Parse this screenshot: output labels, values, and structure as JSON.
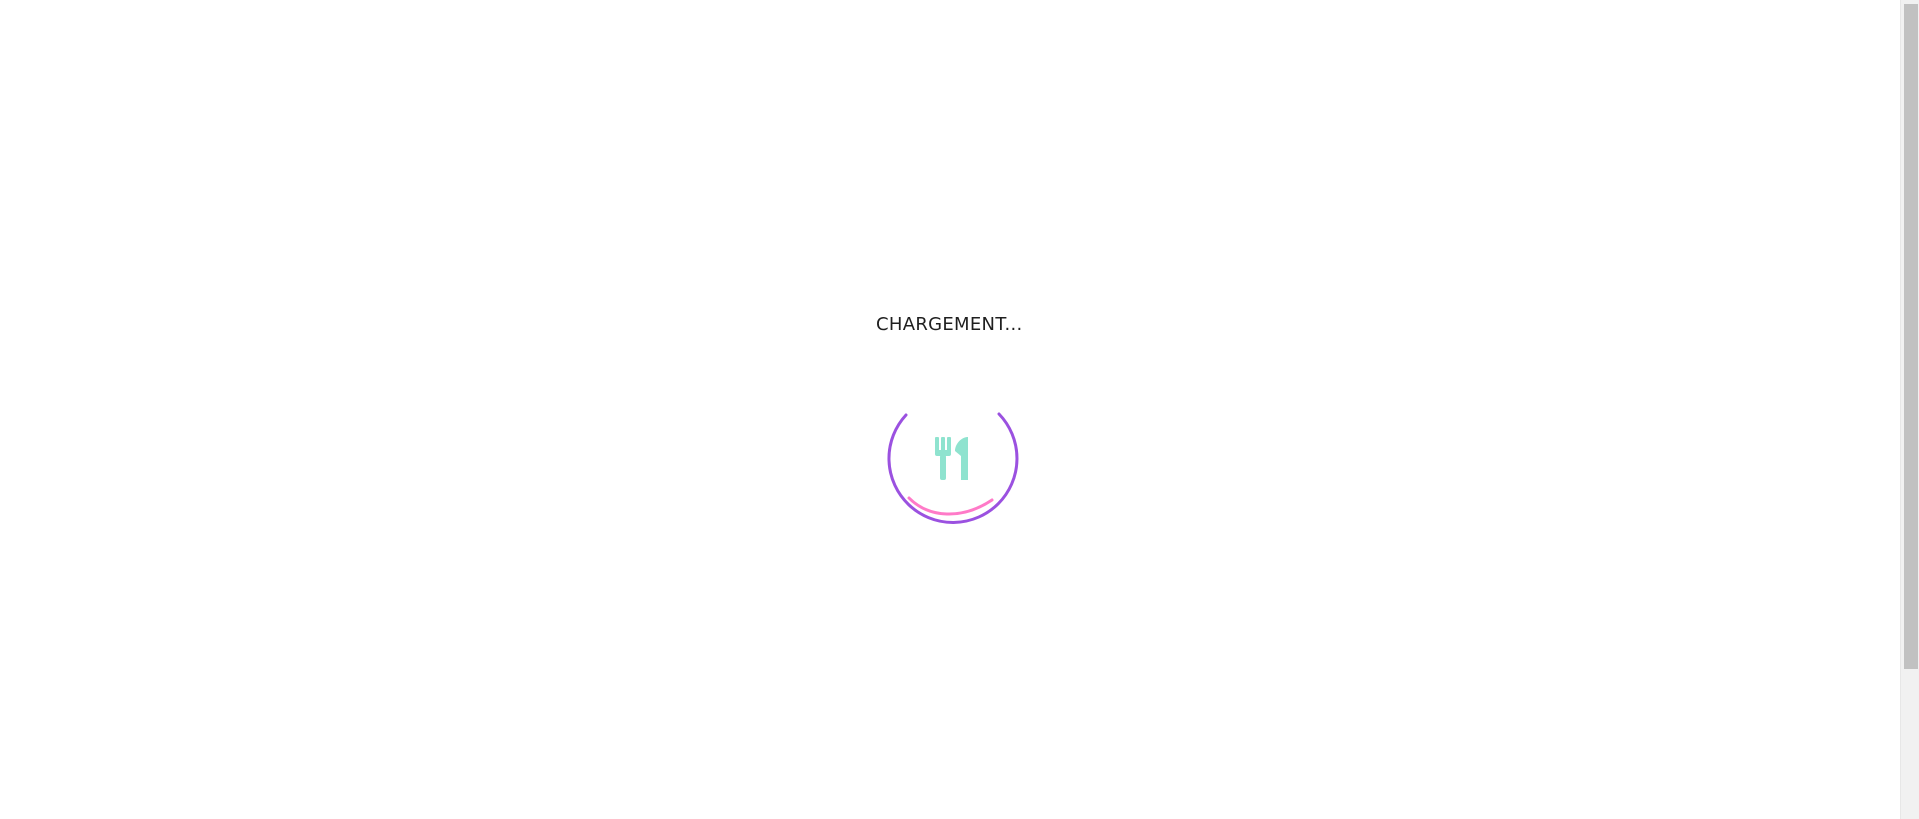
{
  "loading": {
    "text": "CHARGEMENT..."
  },
  "loader_icon": {
    "name": "fork-knife-icon",
    "ring_color": "#9b51e0",
    "accent_arc_color": "#ff7ac8",
    "icon_color": "#8fe3cf"
  },
  "scrollbar": {
    "track_color": "#f1f1f1",
    "thumb_color": "#c1c1c1"
  }
}
